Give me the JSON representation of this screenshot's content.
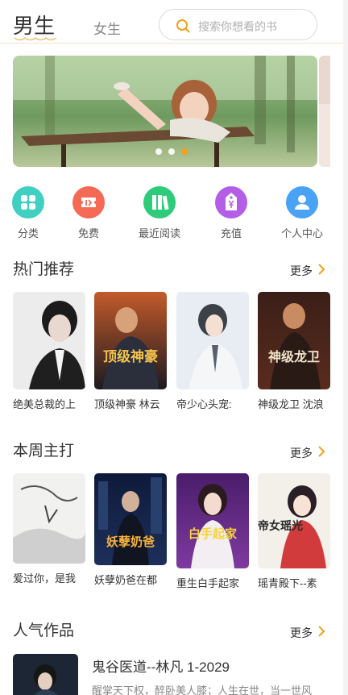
{
  "header": {
    "tab_male": "男生",
    "tab_female": "女生",
    "search_placeholder": "搜索你想看的书"
  },
  "banner": {
    "slide_count": 3,
    "active_index": 2,
    "accent_color": "#f0a11e"
  },
  "quick_entries": [
    {
      "label": "分类",
      "icon": "grid-icon",
      "color": "#3fd0c2"
    },
    {
      "label": "免费",
      "icon": "free-ticket-icon",
      "color": "#f46a55"
    },
    {
      "label": "最近阅读",
      "icon": "books-icon",
      "color": "#2ecc7a"
    },
    {
      "label": "充值",
      "icon": "yen-tag-icon",
      "color": "#b45ee8"
    },
    {
      "label": "个人中心",
      "icon": "user-icon",
      "color": "#4aa2f5"
    }
  ],
  "sections": {
    "hot": {
      "title": "热门推荐",
      "more": "更多",
      "books": [
        {
          "title": "绝美总裁的上"
        },
        {
          "title": "顶级神豪 林云"
        },
        {
          "title": "帝少心头宠:"
        },
        {
          "title": "神级龙卫 沈浪"
        }
      ]
    },
    "weekly": {
      "title": "本周主打",
      "more": "更多",
      "books": [
        {
          "title": "爱过你，是我"
        },
        {
          "title": "妖孽奶爸在都"
        },
        {
          "title": "重生白手起家"
        },
        {
          "title": "瑶青殿下--素"
        }
      ]
    },
    "popular": {
      "title": "人气作品",
      "more": "更多",
      "items": [
        {
          "title": "鬼谷医道--林凡 1-2029",
          "desc": "醒掌天下权，醉卧美人膝；人生在世，当一世风"
        }
      ]
    }
  },
  "cover_art": {
    "hot": [
      "顶级神豪",
      "神级龙卫"
    ],
    "weekly": [
      "妖孽奶爸",
      "白手起家",
      "帝女瑶光"
    ]
  }
}
